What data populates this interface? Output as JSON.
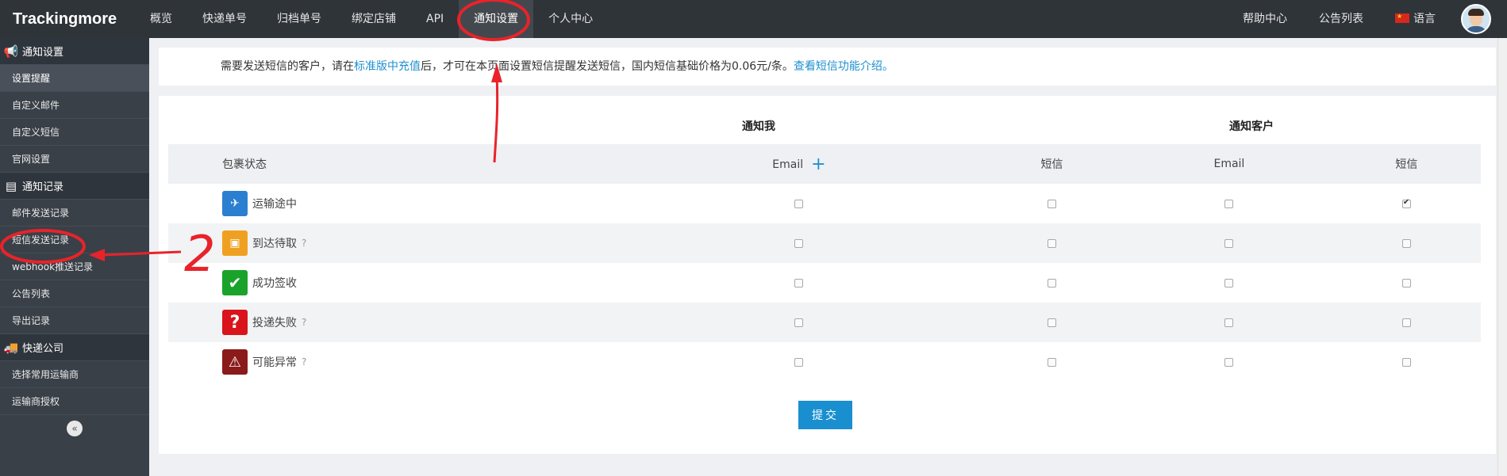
{
  "brand": "Trackingmore",
  "nav": [
    {
      "label": "概览"
    },
    {
      "label": "快递单号"
    },
    {
      "label": "归档单号"
    },
    {
      "label": "绑定店铺"
    },
    {
      "label": "API"
    },
    {
      "label": "通知设置"
    },
    {
      "label": "个人中心"
    }
  ],
  "nav_right": {
    "help": "帮助中心",
    "announcements": "公告列表",
    "language": "语言"
  },
  "sidebar": {
    "sections": [
      {
        "title": "通知设置",
        "icon": "megaphone-icon",
        "items": [
          "设置提醒",
          "自定义邮件",
          "自定义短信",
          "官网设置"
        ]
      },
      {
        "title": "通知记录",
        "icon": "document-icon",
        "items": [
          "邮件发送记录",
          "短信发送记录",
          "webhook推送记录",
          "公告列表",
          "导出记录"
        ]
      },
      {
        "title": "快递公司",
        "icon": "truck-icon",
        "items": [
          "选择常用运输商",
          "运输商授权"
        ]
      }
    ],
    "collapse_icon": "double-chevron-left-icon"
  },
  "notice": {
    "text1": "需要发送短信的客户，请在",
    "link1": "标准版中充值",
    "text2": "后，才可在本页面设置短信提醒发送短信，国内短信基础价格为0.06元/条。",
    "link2": "查看短信功能介绍。"
  },
  "table": {
    "group_me": "通知我",
    "group_customer": "通知客户",
    "headers": [
      "包裹状态",
      "Email",
      "短信",
      "Email",
      "短信"
    ],
    "rows": [
      {
        "status": "运输途中",
        "icon": "plane-globe-icon",
        "color": "#2b7fd1",
        "help": false,
        "checks": [
          false,
          false,
          false,
          true
        ]
      },
      {
        "status": "到达待取",
        "icon": "pickup-box-icon",
        "color": "#f0a020",
        "help": true,
        "checks": [
          false,
          false,
          false,
          false
        ]
      },
      {
        "status": "成功签收",
        "icon": "checkmark-icon",
        "color": "#1aa32a",
        "help": false,
        "checks": [
          false,
          false,
          false,
          false
        ]
      },
      {
        "status": "投递失败",
        "icon": "question-icon",
        "color": "#d9141b",
        "help": true,
        "checks": [
          false,
          false,
          false,
          false
        ]
      },
      {
        "status": "可能异常",
        "icon": "warning-icon",
        "color": "#8b1a1a",
        "help": true,
        "checks": [
          false,
          false,
          false,
          false
        ]
      }
    ],
    "help_mark": "?"
  },
  "submit_label": "提交",
  "annotation_number": "2",
  "colors": {
    "accent": "#1a8fd0",
    "annotation": "#e8232a",
    "topbar": "#2f3439",
    "sidebar": "#3a4048"
  }
}
